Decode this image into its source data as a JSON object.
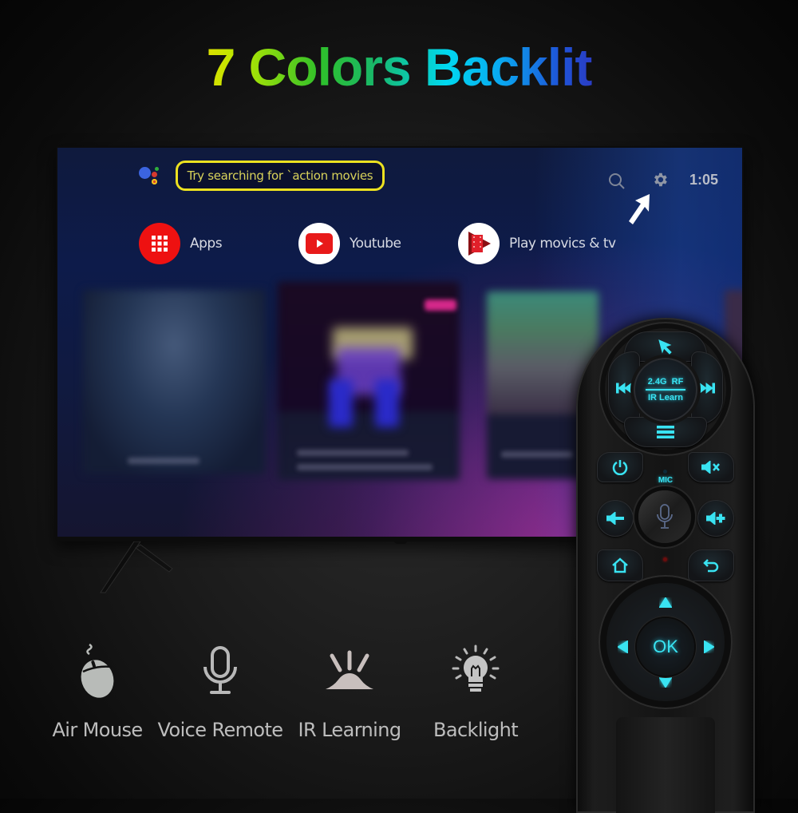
{
  "headline": {
    "text": "7 Colors Backlit",
    "gradient_colors": [
      "#ff1a1a",
      "#ff8a00",
      "#ffd800",
      "#b8e800",
      "#2fc02a",
      "#18b86a",
      "#00d8f0",
      "#1e55d8",
      "#3a1aa8",
      "#9a10c0",
      "#ff10c8"
    ]
  },
  "tv": {
    "assistant_icon": "google-assistant-icon",
    "search_suggestion": "Try searching for `action movies",
    "header": {
      "search_icon": "search-icon",
      "settings_icon": "gear-icon",
      "time": "1:05",
      "pointer_icon": "arrow-pointer-icon"
    },
    "apps": [
      {
        "label": "Apps",
        "icon": "grid-icon",
        "color": "#ee1111"
      },
      {
        "label": "Youtube",
        "icon": "youtube-icon",
        "color": "#ffffff"
      },
      {
        "label": "Play movics & tv",
        "icon": "play-movies-icon",
        "color": "#ffffff"
      }
    ]
  },
  "remote": {
    "center_top_label": "2.4G  RF",
    "center_bottom_label": "IR Learn",
    "mic_label": "MIC",
    "ok_label": "OK",
    "accent_color": "#39e3f2",
    "buttons": [
      "mouse-pointer",
      "previous-track",
      "next-track",
      "menu",
      "power",
      "mute",
      "voice",
      "volume-down",
      "volume-up",
      "home",
      "back",
      "up",
      "down",
      "left",
      "right",
      "ok"
    ]
  },
  "features": [
    {
      "label": "Air Mouse",
      "icon": "mouse-icon"
    },
    {
      "label": "Voice Remote",
      "icon": "microphone-icon"
    },
    {
      "label": "IR Learning",
      "icon": "ir-signal-icon"
    },
    {
      "label": "Backlight",
      "icon": "lightbulb-icon"
    }
  ]
}
